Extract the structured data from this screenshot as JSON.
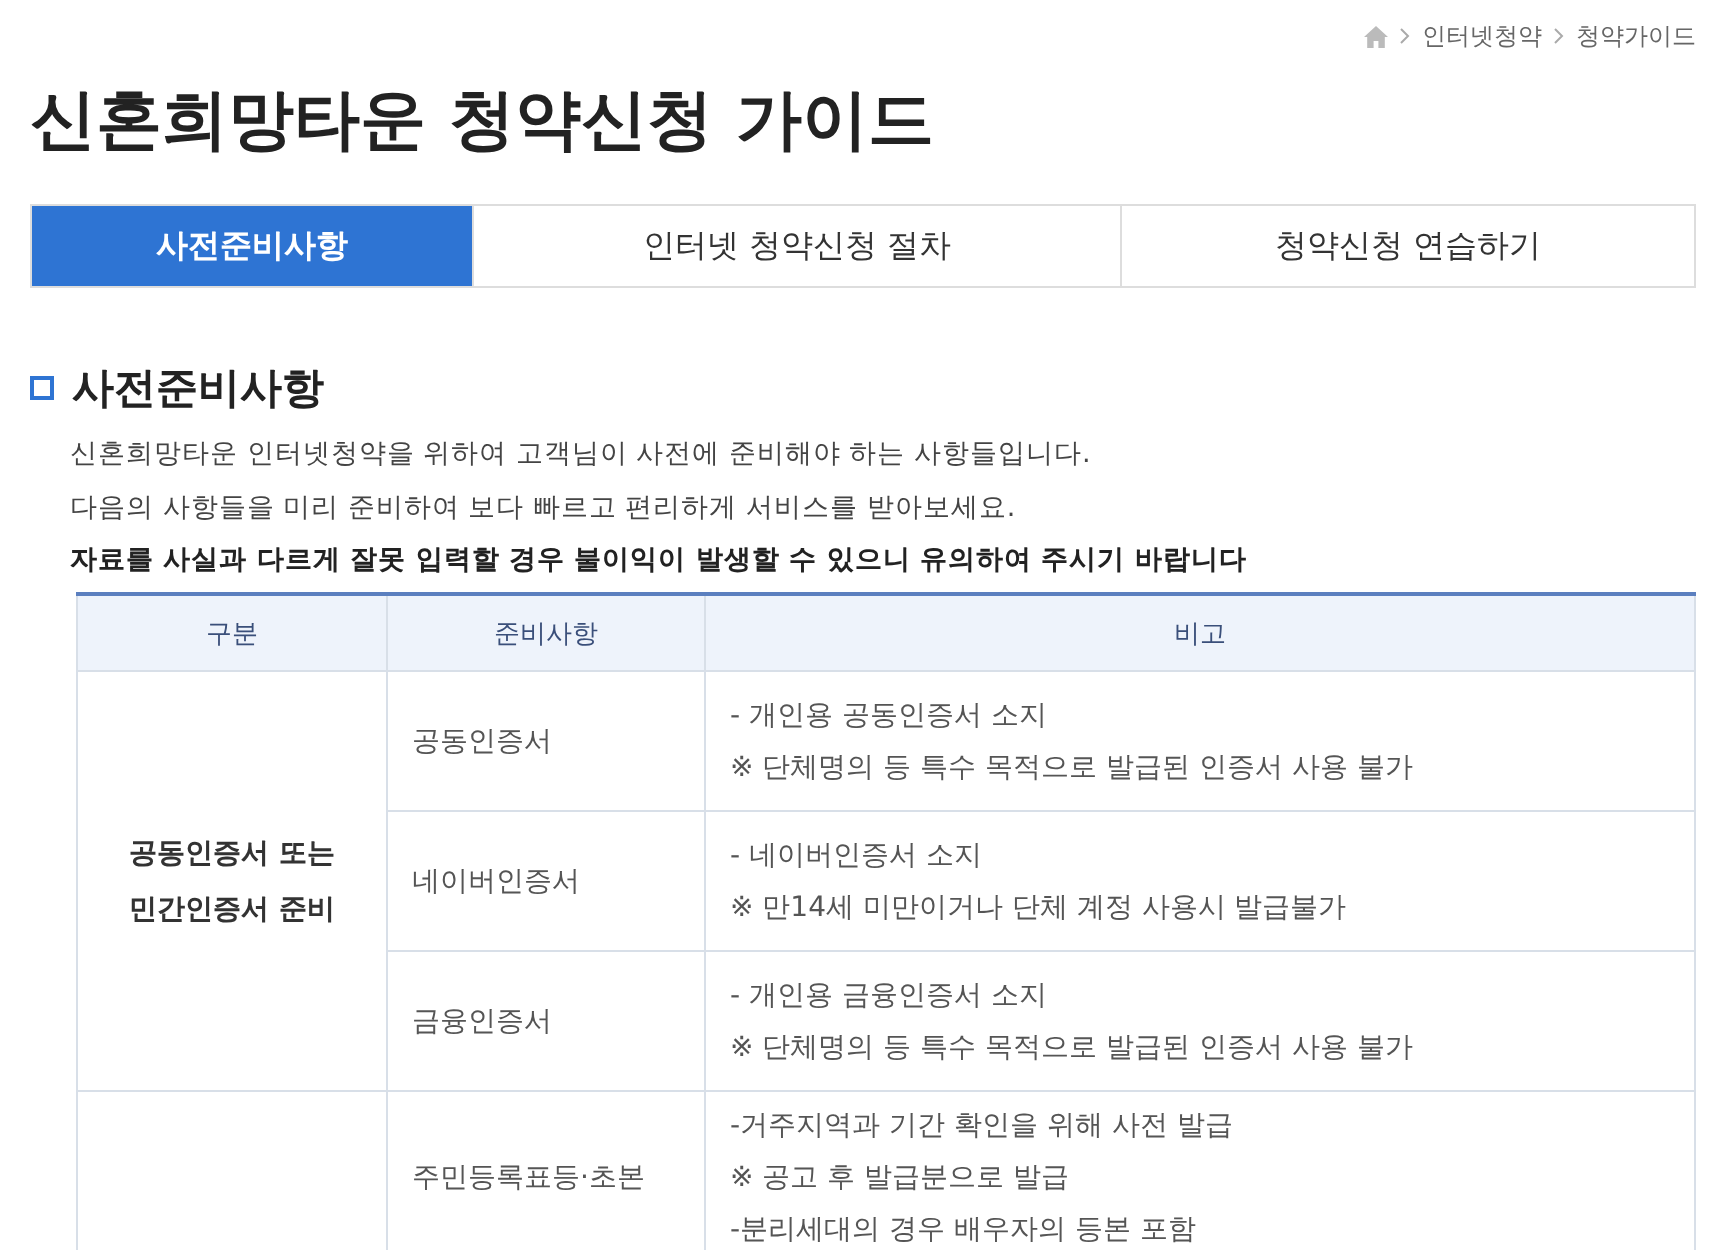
{
  "breadcrumb": [
    "인터넷청약",
    "청약가이드"
  ],
  "title": "신혼희망타운 청약신청 가이드",
  "tabs": [
    {
      "label": "사전준비사항",
      "selected": true
    },
    {
      "label": "인터넷 청약신청 절차",
      "selected": false
    },
    {
      "label": "청약신청 연습하기",
      "selected": false
    }
  ],
  "section": {
    "heading": "사전준비사항",
    "paragraphs": [
      "신혼희망타운 인터넷청약을 위하여 고객님이 사전에 준비해야 하는 사항들입니다.",
      "다음의 사항들을 미리 준비하여 보다 빠르고 편리하게 서비스를 받아보세요."
    ],
    "warning": "자료를 사실과 다르게 잘못 입력할 경우 불이익이 발생할 수 있으니 유의하여 주시기 바랍니다"
  },
  "table": {
    "columns": [
      "구분",
      "준비사항",
      "비고"
    ],
    "groups": [
      {
        "category": "공동인증서 또는\n민간인증서 준비",
        "items": [
          {
            "name": "공동인증서",
            "notes": [
              "- 개인용 공동인증서 소지",
              "※ 단체명의 등 특수 목적으로 발급된 인증서 사용 불가"
            ]
          },
          {
            "name": "네이버인증서",
            "notes": [
              "- 네이버인증서 소지",
              "※ 만14세 미만이거나 단체 계정 사용시 발급불가"
            ]
          },
          {
            "name": "금융인증서",
            "notes": [
              "- 개인용 금융인증서 소지",
              "※ 단체명의 등 특수 목적으로 발급된 인증서 사용 불가"
            ]
          }
        ]
      },
      {
        "items": [
          {
            "name": "주민등록표등·초본",
            "notes": [
              "-거주지역과 기간 확인을 위해 사전 발급",
              "※ 공고 후 발급분으로 발급",
              "-분리세대의 경우 배우자의 등본 포함"
            ]
          }
        ]
      }
    ]
  }
}
